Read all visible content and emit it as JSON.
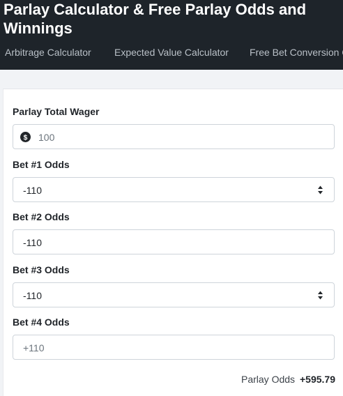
{
  "header": {
    "title": "Parlay Calculator & Free Parlay Odds and Winnings",
    "nav": [
      "Arbitrage Calculator",
      "Expected Value Calculator",
      "Free Bet Conversion C"
    ]
  },
  "form": {
    "wager_label": "Parlay Total Wager",
    "wager_placeholder": "100",
    "wager_icon": "dollar-circle-icon",
    "bets": [
      {
        "label": "Bet #1 Odds",
        "value": "-110"
      },
      {
        "label": "Bet #2 Odds",
        "value": "-110"
      },
      {
        "label": "Bet #3 Odds",
        "value": "-110"
      },
      {
        "label": "Bet #4 Odds",
        "placeholder": "+110"
      }
    ]
  },
  "result": {
    "label": "Parlay Odds",
    "value": "+595.79"
  }
}
